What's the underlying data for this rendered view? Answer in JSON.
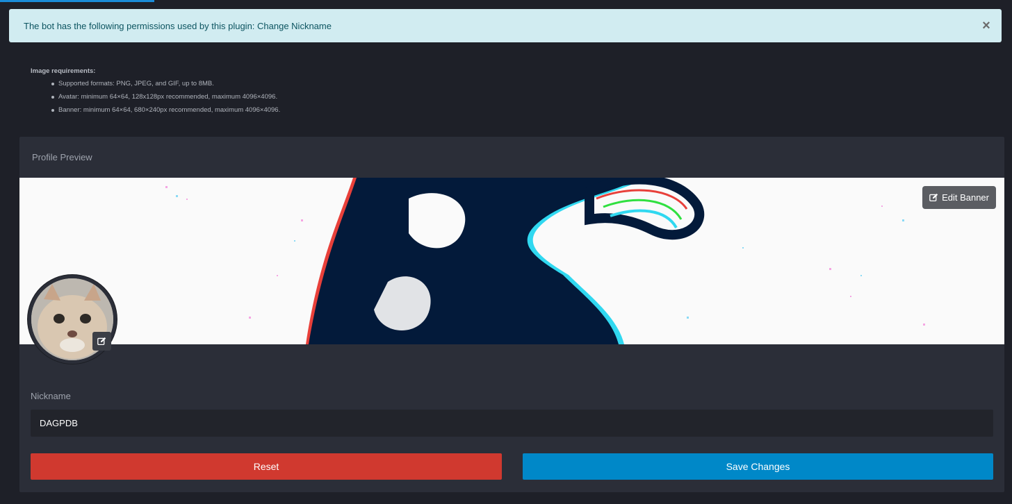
{
  "alert": {
    "message": "The bot has the following permissions used by this plugin: Change Nickname",
    "close_symbol": "×"
  },
  "requirements": {
    "title": "Image requirements",
    "items": [
      "Supported formats: PNG, JPEG, and GIF, up to 8MB.",
      "Avatar: minimum 64×64, 128x128px recommended, maximum 4096×4096.",
      "Banner: minimum 64×64, 680×240px recommended, maximum 4096×4096."
    ]
  },
  "profile": {
    "title": "Profile Preview",
    "edit_banner_label": "Edit Banner",
    "nickname_label": "Nickname",
    "nickname_value": "DAGPDB"
  },
  "actions": {
    "reset_label": "Reset",
    "save_label": "Save Changes"
  },
  "colors": {
    "alert_bg": "#d1ecf1",
    "reset": "#d0392f",
    "save": "#0088c8",
    "background": "#1e2028",
    "card": "#2b2e38"
  }
}
